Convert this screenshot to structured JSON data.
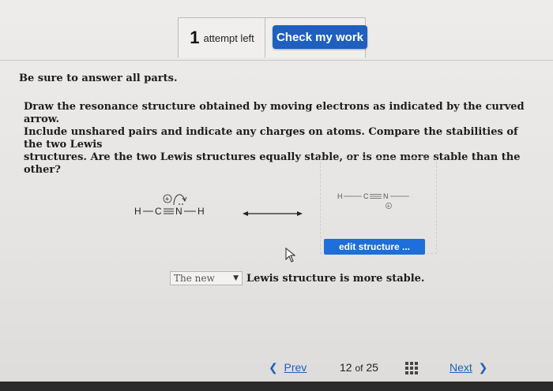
{
  "header": {
    "attempt_count": "1",
    "attempt_label": "attempt left",
    "check_label": "Check my work"
  },
  "question": {
    "instruction": "Be sure to answer all parts.",
    "lines": [
      "Draw the resonance structure obtained by moving electrons as indicated by the curved arrow.",
      "Include unshared pairs and indicate any charges on atoms. Compare the stabilities of the two Lewis",
      "structures. Are the two Lewis structures equally stable, or is one more stable than the other?"
    ]
  },
  "structure_left": {
    "atoms": [
      "H",
      "C",
      "N",
      "H"
    ],
    "charge": "+"
  },
  "structure_right": {
    "atoms": [
      "H",
      "C",
      "N"
    ],
    "charge": "+"
  },
  "edit_structure_label": "edit structure ...",
  "answer": {
    "selected": "The new",
    "rest": "Lewis structure is more stable."
  },
  "nav": {
    "prev_label": "Prev",
    "current": "12",
    "of_word": "of",
    "total": "25",
    "next_label": "Next"
  },
  "colors": {
    "accent_blue": "#1e5fbf",
    "edit_blue": "#1e6fd9"
  },
  "icons": [
    "curved-arrow-icon",
    "resonance-arrow-icon",
    "mouse-cursor-icon",
    "chevron-left-icon",
    "chevron-right-icon",
    "grid-icon",
    "dropdown-caret-icon"
  ]
}
